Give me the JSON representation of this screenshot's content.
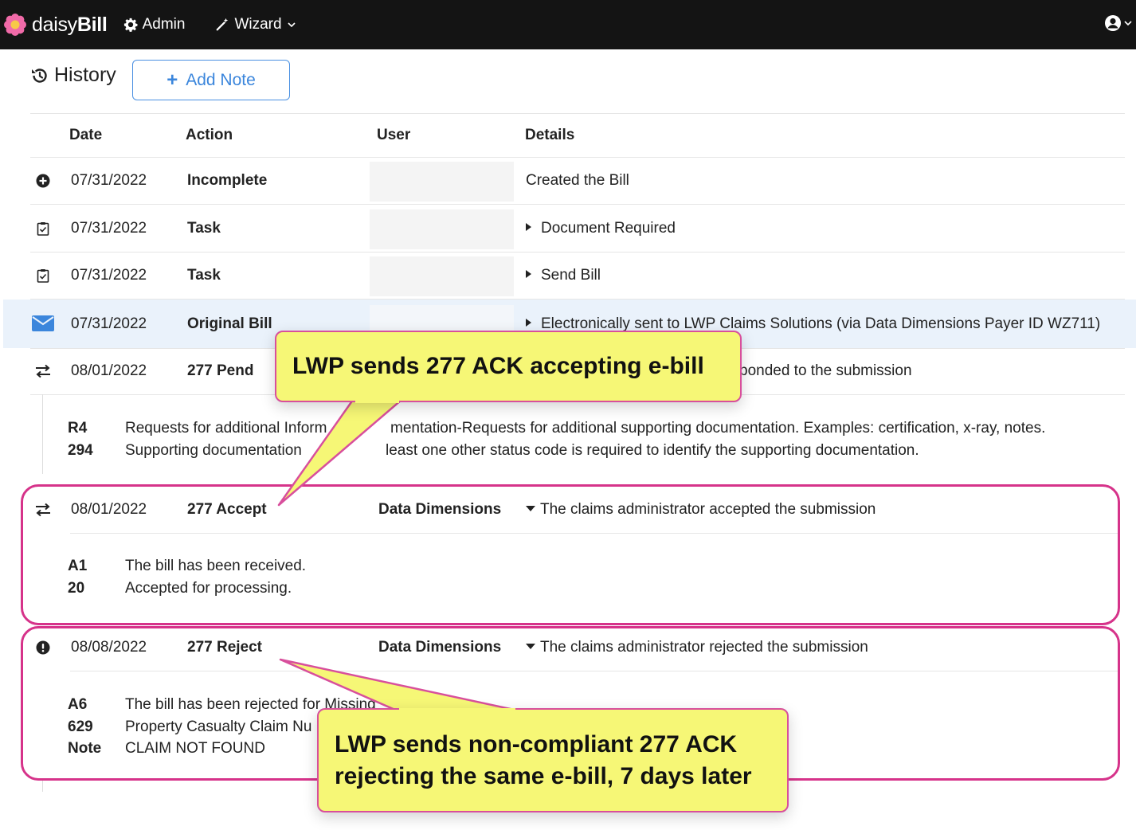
{
  "navbar": {
    "brand_prefix": "daisy",
    "brand_suffix": "Bill",
    "admin_label": "Admin",
    "wizard_label": "Wizard"
  },
  "history": {
    "title": "History",
    "add_note_label": "Add Note"
  },
  "table": {
    "columns": [
      "Date",
      "Action",
      "User",
      "Details"
    ],
    "rows": [
      {
        "date": "07/31/2022",
        "action": "Incomplete",
        "user": "",
        "details": "Created the Bill",
        "icon": "plus-circle-icon"
      },
      {
        "date": "07/31/2022",
        "action": "Task",
        "user": "",
        "details": "Document Required",
        "icon": "clipboard-check-icon"
      },
      {
        "date": "07/31/2022",
        "action": "Task",
        "user": "",
        "details": "Send Bill",
        "icon": "clipboard-check-icon"
      },
      {
        "date": "07/31/2022",
        "action": "Original Bill",
        "user": "",
        "details": "Electronically sent to LWP Claims Solutions (via Data Dimensions Payer ID WZ711)",
        "icon": "envelope-icon"
      },
      {
        "date": "08/01/2022",
        "action": "277 Pend",
        "user": "",
        "details": "ponded to the submission",
        "icon": "exchange-icon",
        "codes": [
          {
            "code": "R4",
            "text": "Requests for additional Inform",
            "text2": "mentation-Requests for additional supporting documentation. Examples: certification, x-ray, notes."
          },
          {
            "code": "294",
            "text": "Supporting documentation",
            "text2": "least one other status code is required to identify the supporting documentation."
          }
        ]
      },
      {
        "date": "08/01/2022",
        "action": "277 Accept",
        "user": "Data Dimensions",
        "details": "The claims administrator accepted the submission",
        "icon": "exchange-icon",
        "codes": [
          {
            "code": "A1",
            "text": "The bill has been received."
          },
          {
            "code": "20",
            "text": "Accepted for processing."
          }
        ]
      },
      {
        "date": "08/08/2022",
        "action": "277 Reject",
        "user": "Data Dimensions",
        "details": "The claims administrator rejected the submission",
        "icon": "exclamation-circle-icon",
        "codes": [
          {
            "code": "A6",
            "text": "The bill has been rejected for Missing"
          },
          {
            "code": "629",
            "text": "Property Casualty Claim Nu"
          },
          {
            "code": "Note",
            "text": "CLAIM NOT FOUND"
          }
        ]
      }
    ]
  },
  "callouts": {
    "top": "LWP sends 277 ACK accepting e-bill",
    "bottom_line1": "LWP sends non-compliant 277 ACK",
    "bottom_line2": "rejecting the same e-bill, 7 days later"
  },
  "colors": {
    "navbar": "#141414",
    "accent": "#3b86dc",
    "highlight_row": "#eaf2fb",
    "callout_fill": "#f6f776",
    "callout_border": "#d84f9c",
    "highlight_box": "#d6338a"
  }
}
